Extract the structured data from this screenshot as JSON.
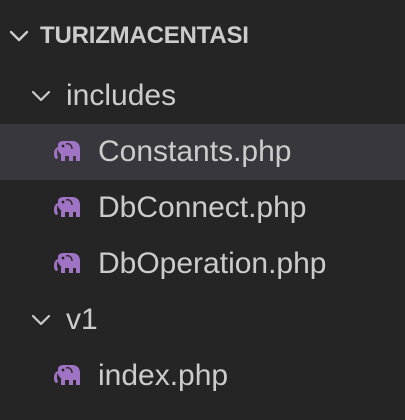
{
  "explorer": {
    "root": {
      "label": "TURIZMACENTASI",
      "icon": "chevron-down-icon"
    },
    "items": [
      {
        "type": "folder",
        "label": "includes",
        "icon": "chevron-down-icon"
      },
      {
        "type": "file",
        "label": "Constants.php",
        "icon": "php-elephant-icon",
        "selected": true
      },
      {
        "type": "file",
        "label": "DbConnect.php",
        "icon": "php-elephant-icon"
      },
      {
        "type": "file",
        "label": "DbOperation.php",
        "icon": "php-elephant-icon"
      },
      {
        "type": "folder",
        "label": "v1",
        "icon": "chevron-down-icon"
      },
      {
        "type": "file",
        "label": "index.php",
        "icon": "php-elephant-icon"
      }
    ]
  },
  "colors": {
    "background": "#252526",
    "selected_row": "#37373d",
    "text": "#cccccc",
    "php_icon": "#a074c4"
  }
}
